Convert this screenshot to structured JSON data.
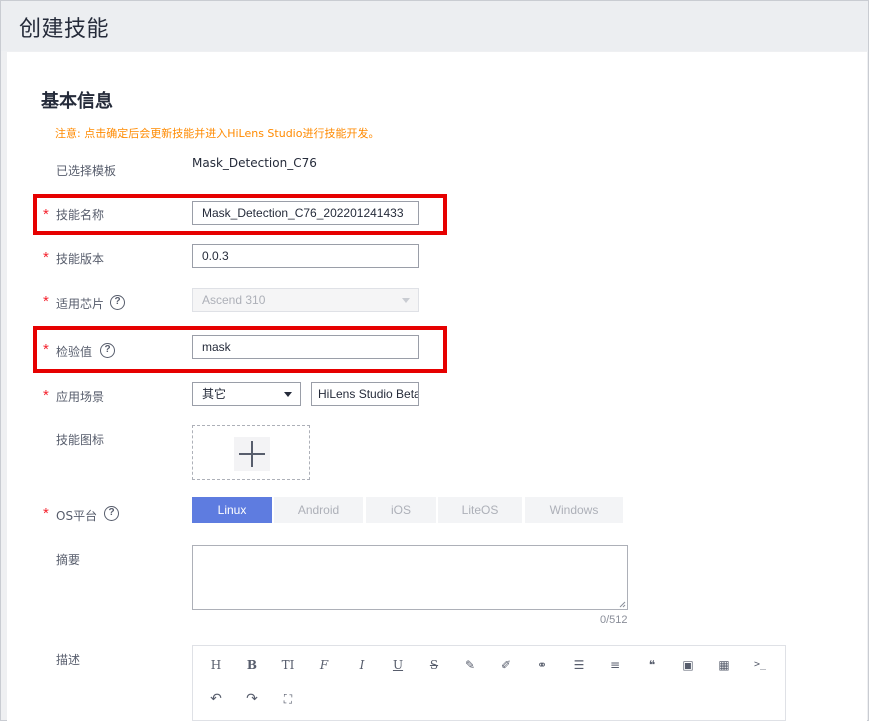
{
  "page": {
    "title": "创建技能"
  },
  "section": {
    "title": "基本信息",
    "notice": "注意: 点击确定后会更新技能并进入HiLens Studio进行技能开发。"
  },
  "form": {
    "template": {
      "label": "已选择模板",
      "value": "Mask_Detection_C76"
    },
    "skill_name": {
      "label": "技能名称",
      "value": "Mask_Detection_C76_202201241433"
    },
    "skill_version": {
      "label": "技能版本",
      "value": "0.0.3"
    },
    "chip": {
      "label": "适用芯片",
      "value": "Ascend 310"
    },
    "checksum": {
      "label": "检验值",
      "value": "mask"
    },
    "scenario": {
      "label": "应用场景",
      "value": "其它",
      "extra_value": "HiLens Studio Beta"
    },
    "icon": {
      "label": "技能图标"
    },
    "os": {
      "label": "OS平台",
      "options": [
        "Linux",
        "Android",
        "iOS",
        "LiteOS",
        "Windows"
      ],
      "selected": "Linux"
    },
    "summary": {
      "label": "摘要",
      "counter": "0/512"
    },
    "description": {
      "label": "描述"
    }
  },
  "required_mark": "*",
  "help_mark": "?",
  "toolbar": {
    "icons": [
      {
        "name": "heading-icon",
        "glyph": "H"
      },
      {
        "name": "bold-icon",
        "glyph": "B"
      },
      {
        "name": "font-size-icon",
        "glyph": "TI"
      },
      {
        "name": "font-icon",
        "glyph": "F"
      },
      {
        "name": "italic-icon",
        "glyph": "I"
      },
      {
        "name": "underline-icon",
        "glyph": "U"
      },
      {
        "name": "strikethrough-icon",
        "glyph": "S"
      },
      {
        "name": "highlight-pen-icon",
        "glyph": "✎"
      },
      {
        "name": "brush-icon",
        "glyph": "✐"
      },
      {
        "name": "link-icon",
        "glyph": "⚭"
      },
      {
        "name": "bullet-list-icon",
        "glyph": "☰"
      },
      {
        "name": "align-icon",
        "glyph": "≡"
      },
      {
        "name": "quote-icon",
        "glyph": "❝"
      },
      {
        "name": "image-icon",
        "glyph": "▣"
      },
      {
        "name": "table-icon",
        "glyph": "▦"
      },
      {
        "name": "code-icon",
        "glyph": ">_"
      },
      {
        "name": "undo-icon",
        "glyph": "↶"
      },
      {
        "name": "redo-icon",
        "glyph": "↷"
      },
      {
        "name": "fullscreen-icon",
        "glyph": "⛶"
      }
    ]
  },
  "colors": {
    "accent": "#5e7ce0",
    "required": "#f5222d",
    "notice": "#ff8a00",
    "highlight_box": "#e60000"
  }
}
